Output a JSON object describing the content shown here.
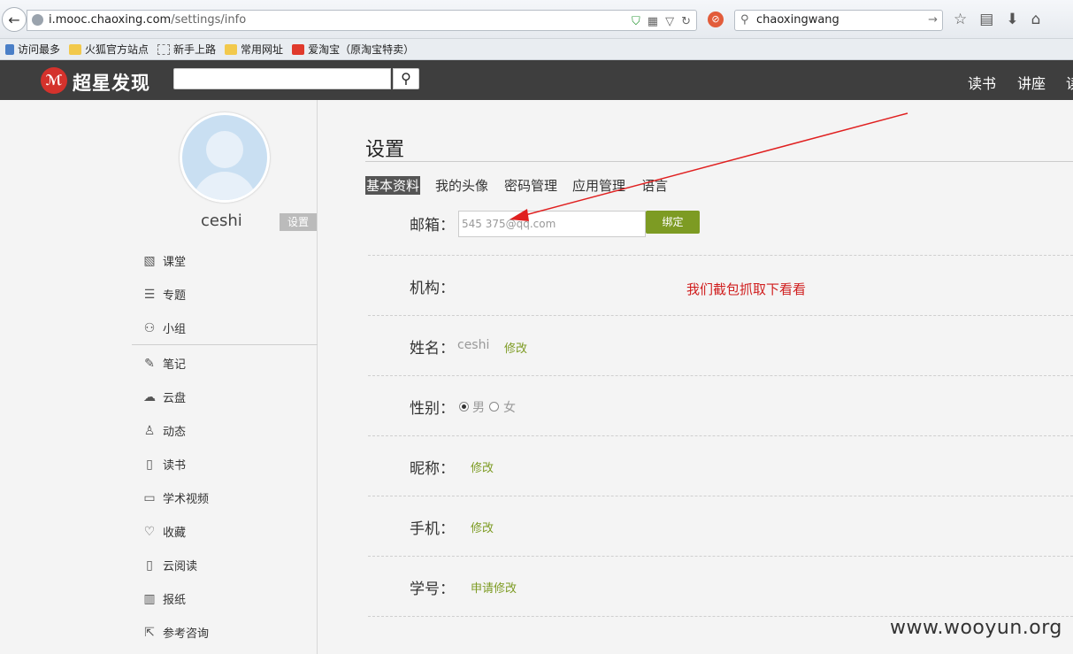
{
  "browser": {
    "url_host": "i.mooc.chaoxing.com",
    "url_path": "/settings/info",
    "search_query": "chaoxingwang",
    "bookmarks": [
      "访问最多",
      "火狐官方站点",
      "新手上路",
      "常用网址",
      "爱淘宝（原淘宝特卖）"
    ]
  },
  "header": {
    "logo_text": "超星发现",
    "nav": [
      "读书",
      "讲座",
      "读"
    ]
  },
  "sidebar": {
    "username": "ceshi",
    "settings_label": "设置",
    "items": [
      {
        "label": "课堂",
        "icon": "classroom-icon",
        "glyph": "▧"
      },
      {
        "label": "专题",
        "icon": "topic-icon",
        "glyph": "☰"
      },
      {
        "label": "小组",
        "icon": "group-icon",
        "glyph": "⚇"
      },
      {
        "label": "笔记",
        "icon": "note-icon",
        "glyph": "✎"
      },
      {
        "label": "云盘",
        "icon": "cloud-icon",
        "glyph": "☁"
      },
      {
        "label": "动态",
        "icon": "user-icon",
        "glyph": "♙"
      },
      {
        "label": "读书",
        "icon": "book-icon",
        "glyph": "▯"
      },
      {
        "label": "学术视频",
        "icon": "video-icon",
        "glyph": "▭"
      },
      {
        "label": "收藏",
        "icon": "heart-icon",
        "glyph": "♡"
      },
      {
        "label": "云阅读",
        "icon": "reading-icon",
        "glyph": "▯"
      },
      {
        "label": "报纸",
        "icon": "newspaper-icon",
        "glyph": "▥"
      },
      {
        "label": "参考咨询",
        "icon": "consult-icon",
        "glyph": "⇱"
      }
    ]
  },
  "main": {
    "title": "设置",
    "tabs": [
      "基本资料",
      "我的头像",
      "密码管理",
      "应用管理",
      "语言"
    ],
    "fields": {
      "email_label": "邮箱：",
      "email_value": "545     375@qq.com",
      "bind_label": "绑定",
      "org_label": "机构：",
      "name_label": "姓名：",
      "name_value": "ceshi",
      "edit_label": "修改",
      "gender_label": "性别：",
      "male": "男",
      "female": "女",
      "nickname_label": "昵称：",
      "phone_label": "手机：",
      "student_id_label": "学号：",
      "apply_edit_label": "申请修改"
    },
    "annotation": "我们截包抓取下看看"
  },
  "watermark": "www.wooyun.org",
  "colors": {
    "accent": "#7d9b23",
    "annotation": "#d01e1e",
    "header_bg": "#3e3e3e"
  }
}
